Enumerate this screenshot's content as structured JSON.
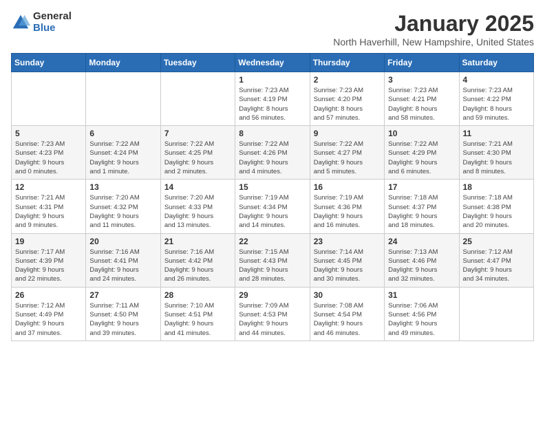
{
  "logo": {
    "general": "General",
    "blue": "Blue"
  },
  "header": {
    "month": "January 2025",
    "location": "North Haverhill, New Hampshire, United States"
  },
  "weekdays": [
    "Sunday",
    "Monday",
    "Tuesday",
    "Wednesday",
    "Thursday",
    "Friday",
    "Saturday"
  ],
  "weeks": [
    [
      {
        "day": "",
        "info": ""
      },
      {
        "day": "",
        "info": ""
      },
      {
        "day": "",
        "info": ""
      },
      {
        "day": "1",
        "info": "Sunrise: 7:23 AM\nSunset: 4:19 PM\nDaylight: 8 hours\nand 56 minutes."
      },
      {
        "day": "2",
        "info": "Sunrise: 7:23 AM\nSunset: 4:20 PM\nDaylight: 8 hours\nand 57 minutes."
      },
      {
        "day": "3",
        "info": "Sunrise: 7:23 AM\nSunset: 4:21 PM\nDaylight: 8 hours\nand 58 minutes."
      },
      {
        "day": "4",
        "info": "Sunrise: 7:23 AM\nSunset: 4:22 PM\nDaylight: 8 hours\nand 59 minutes."
      }
    ],
    [
      {
        "day": "5",
        "info": "Sunrise: 7:23 AM\nSunset: 4:23 PM\nDaylight: 9 hours\nand 0 minutes."
      },
      {
        "day": "6",
        "info": "Sunrise: 7:22 AM\nSunset: 4:24 PM\nDaylight: 9 hours\nand 1 minute."
      },
      {
        "day": "7",
        "info": "Sunrise: 7:22 AM\nSunset: 4:25 PM\nDaylight: 9 hours\nand 2 minutes."
      },
      {
        "day": "8",
        "info": "Sunrise: 7:22 AM\nSunset: 4:26 PM\nDaylight: 9 hours\nand 4 minutes."
      },
      {
        "day": "9",
        "info": "Sunrise: 7:22 AM\nSunset: 4:27 PM\nDaylight: 9 hours\nand 5 minutes."
      },
      {
        "day": "10",
        "info": "Sunrise: 7:22 AM\nSunset: 4:29 PM\nDaylight: 9 hours\nand 6 minutes."
      },
      {
        "day": "11",
        "info": "Sunrise: 7:21 AM\nSunset: 4:30 PM\nDaylight: 9 hours\nand 8 minutes."
      }
    ],
    [
      {
        "day": "12",
        "info": "Sunrise: 7:21 AM\nSunset: 4:31 PM\nDaylight: 9 hours\nand 9 minutes."
      },
      {
        "day": "13",
        "info": "Sunrise: 7:20 AM\nSunset: 4:32 PM\nDaylight: 9 hours\nand 11 minutes."
      },
      {
        "day": "14",
        "info": "Sunrise: 7:20 AM\nSunset: 4:33 PM\nDaylight: 9 hours\nand 13 minutes."
      },
      {
        "day": "15",
        "info": "Sunrise: 7:19 AM\nSunset: 4:34 PM\nDaylight: 9 hours\nand 14 minutes."
      },
      {
        "day": "16",
        "info": "Sunrise: 7:19 AM\nSunset: 4:36 PM\nDaylight: 9 hours\nand 16 minutes."
      },
      {
        "day": "17",
        "info": "Sunrise: 7:18 AM\nSunset: 4:37 PM\nDaylight: 9 hours\nand 18 minutes."
      },
      {
        "day": "18",
        "info": "Sunrise: 7:18 AM\nSunset: 4:38 PM\nDaylight: 9 hours\nand 20 minutes."
      }
    ],
    [
      {
        "day": "19",
        "info": "Sunrise: 7:17 AM\nSunset: 4:39 PM\nDaylight: 9 hours\nand 22 minutes."
      },
      {
        "day": "20",
        "info": "Sunrise: 7:16 AM\nSunset: 4:41 PM\nDaylight: 9 hours\nand 24 minutes."
      },
      {
        "day": "21",
        "info": "Sunrise: 7:16 AM\nSunset: 4:42 PM\nDaylight: 9 hours\nand 26 minutes."
      },
      {
        "day": "22",
        "info": "Sunrise: 7:15 AM\nSunset: 4:43 PM\nDaylight: 9 hours\nand 28 minutes."
      },
      {
        "day": "23",
        "info": "Sunrise: 7:14 AM\nSunset: 4:45 PM\nDaylight: 9 hours\nand 30 minutes."
      },
      {
        "day": "24",
        "info": "Sunrise: 7:13 AM\nSunset: 4:46 PM\nDaylight: 9 hours\nand 32 minutes."
      },
      {
        "day": "25",
        "info": "Sunrise: 7:12 AM\nSunset: 4:47 PM\nDaylight: 9 hours\nand 34 minutes."
      }
    ],
    [
      {
        "day": "26",
        "info": "Sunrise: 7:12 AM\nSunset: 4:49 PM\nDaylight: 9 hours\nand 37 minutes."
      },
      {
        "day": "27",
        "info": "Sunrise: 7:11 AM\nSunset: 4:50 PM\nDaylight: 9 hours\nand 39 minutes."
      },
      {
        "day": "28",
        "info": "Sunrise: 7:10 AM\nSunset: 4:51 PM\nDaylight: 9 hours\nand 41 minutes."
      },
      {
        "day": "29",
        "info": "Sunrise: 7:09 AM\nSunset: 4:53 PM\nDaylight: 9 hours\nand 44 minutes."
      },
      {
        "day": "30",
        "info": "Sunrise: 7:08 AM\nSunset: 4:54 PM\nDaylight: 9 hours\nand 46 minutes."
      },
      {
        "day": "31",
        "info": "Sunrise: 7:06 AM\nSunset: 4:56 PM\nDaylight: 9 hours\nand 49 minutes."
      },
      {
        "day": "",
        "info": ""
      }
    ]
  ]
}
